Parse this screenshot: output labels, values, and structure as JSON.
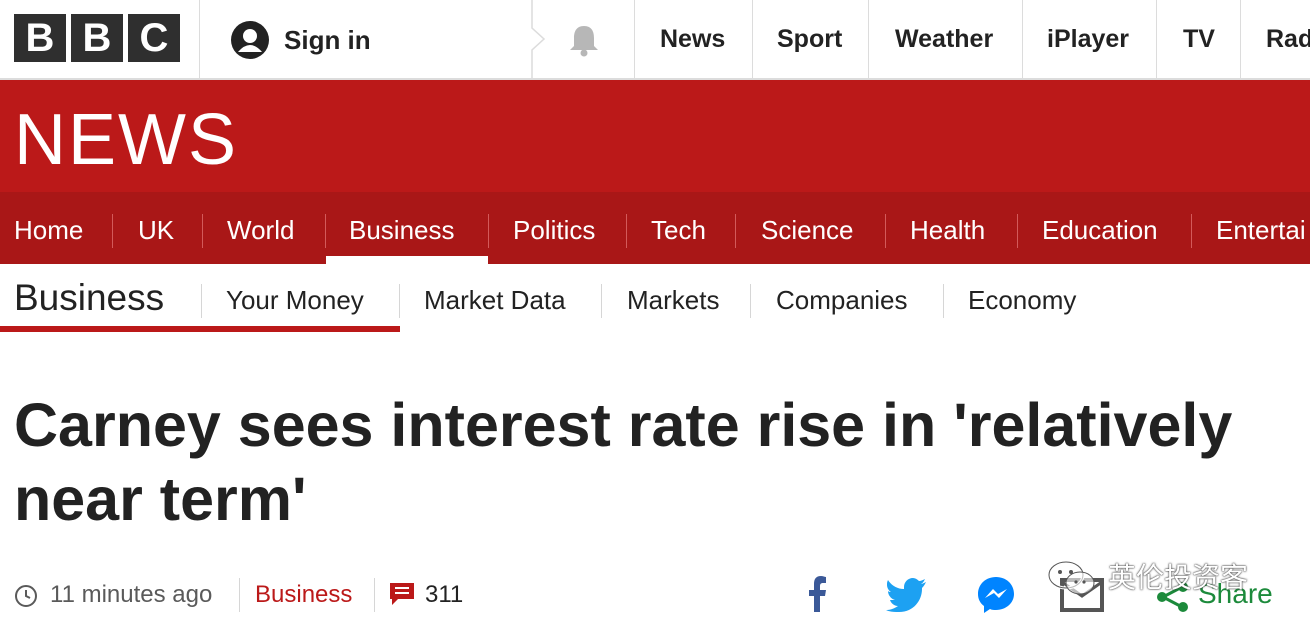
{
  "topbar": {
    "logo_letters": [
      "B",
      "B",
      "C"
    ],
    "sign_in": "Sign in",
    "nav": [
      "News",
      "Sport",
      "Weather",
      "iPlayer",
      "TV",
      "Rad"
    ]
  },
  "banner": {
    "title": "NEWS"
  },
  "section_nav": {
    "items": [
      "Home",
      "UK",
      "World",
      "Business",
      "Politics",
      "Tech",
      "Science",
      "Health",
      "Education",
      "Entertai"
    ],
    "active": "Business"
  },
  "sub_nav": {
    "title": "Business",
    "items": [
      "Your Money",
      "Market Data",
      "Markets",
      "Companies",
      "Economy"
    ]
  },
  "article": {
    "headline": "Carney sees interest rate rise in 'relatively near term'",
    "time": "11 minutes ago",
    "section": "Business",
    "comment_count": "311"
  },
  "share": {
    "icons": [
      "facebook-icon",
      "twitter-icon",
      "messenger-icon",
      "email-icon",
      "share-icon"
    ],
    "label": "Share"
  },
  "watermark": {
    "text": "英伦投资客"
  },
  "colors": {
    "brand_red": "#bb1919",
    "nav_red": "#a91717",
    "facebook": "#3b5998",
    "twitter": "#1da1f2",
    "messenger": "#0084ff",
    "share_green": "#1c8a3b"
  }
}
